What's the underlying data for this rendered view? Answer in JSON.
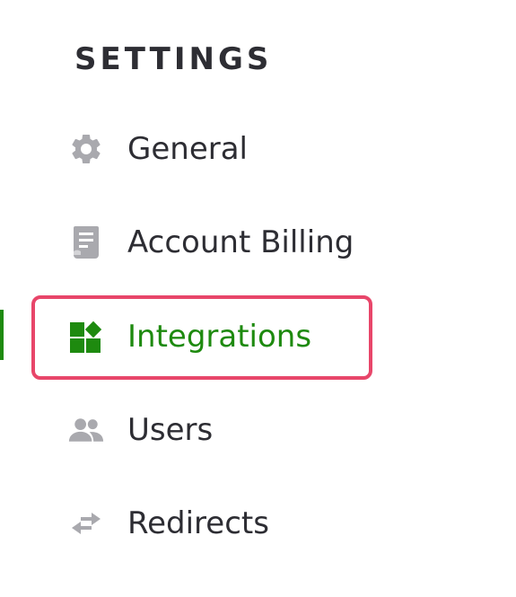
{
  "sidebar": {
    "heading": "SETTINGS",
    "items": [
      {
        "label": "General",
        "icon": "gear-icon",
        "active": false
      },
      {
        "label": "Account Billing",
        "icon": "receipt-icon",
        "active": false
      },
      {
        "label": "Integrations",
        "icon": "integrations-icon",
        "active": true
      },
      {
        "label": "Users",
        "icon": "users-icon",
        "active": false
      },
      {
        "label": "Redirects",
        "icon": "redirect-arrows-icon",
        "active": false
      }
    ]
  },
  "colors": {
    "text": "#2d2d33",
    "icon_muted": "#a9a9ae",
    "active": "#1e8a0f",
    "highlight": "#e8466a"
  }
}
